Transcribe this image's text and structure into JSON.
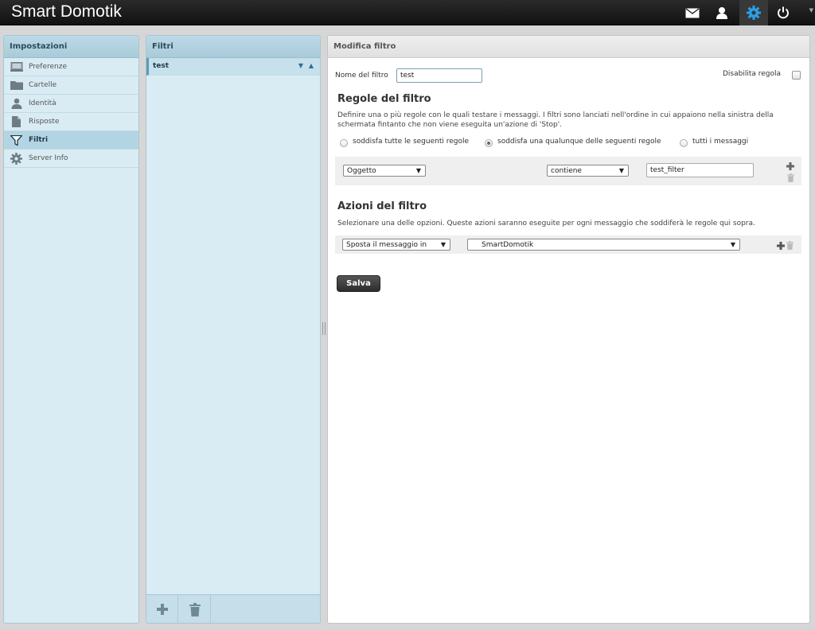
{
  "app": {
    "title": "Smart Domotik"
  },
  "topbar": {
    "icons": [
      "mail-icon",
      "user-icon",
      "settings-gear-icon",
      "power-icon"
    ],
    "active_color": "#2aa0e8"
  },
  "settings_panel": {
    "title": "Impostazioni",
    "items": [
      {
        "label": "Preferenze",
        "icon": "monitor-icon"
      },
      {
        "label": "Cartelle",
        "icon": "folder-icon"
      },
      {
        "label": "Identità",
        "icon": "person-icon"
      },
      {
        "label": "Risposte",
        "icon": "document-icon"
      },
      {
        "label": "Filtri",
        "icon": "funnel-icon",
        "selected": true
      },
      {
        "label": "Server Info",
        "icon": "gear-icon"
      }
    ]
  },
  "filters_panel": {
    "title": "Filtri",
    "items": [
      {
        "label": "test",
        "order_controls": "▼ ▲"
      }
    ]
  },
  "edit_panel": {
    "title": "Modifica filtro",
    "name_label": "Nome del filtro",
    "name_value": "test",
    "disable_label": "Disabilita regola",
    "rules_heading": "Regole del filtro",
    "rules_description": "Definire una o più regole con le quali testare i messaggi. I filtri sono lanciati nell'ordine in cui appaiono nella sinistra della schermata fintanto che non viene eseguita un'azione di 'Stop'.",
    "match_options": [
      {
        "label": "soddisfa tutte le seguenti regole",
        "checked": false
      },
      {
        "label": "soddisfa una qualunque delle seguenti regole",
        "checked": true
      },
      {
        "label": "tutti i messaggi",
        "checked": false
      }
    ],
    "rule": {
      "field": "Oggetto",
      "operator": "contiene",
      "value": "test_filter"
    },
    "actions_heading": "Azioni del filtro",
    "actions_description": "Selezionare una delle opzioni. Queste azioni saranno eseguite per ogni messaggio che soddiferà le regole qui sopra.",
    "action": {
      "type": "Sposta il messaggio in",
      "target": "SmartDomotik"
    },
    "save_label": "Salva"
  }
}
